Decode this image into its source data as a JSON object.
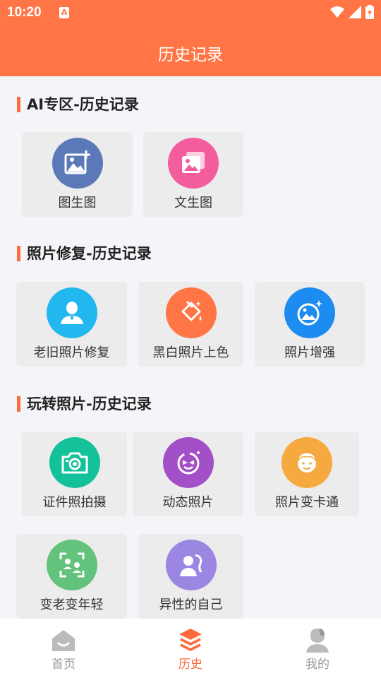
{
  "status_bar": {
    "time": "10:20",
    "app_badge": "A"
  },
  "header": {
    "title": "历史记录"
  },
  "sections": [
    {
      "title": "AI专区-历史记录",
      "cards": [
        {
          "label": "图生图",
          "icon": "image-add-icon",
          "color": "#5b79b8"
        },
        {
          "label": "文生图",
          "icon": "gallery-icon",
          "color": "#f35c9d"
        }
      ]
    },
    {
      "title": "照片修复-历史记录",
      "cards": [
        {
          "label": "老旧照片修复",
          "icon": "person-icon",
          "color": "#22b7ee"
        },
        {
          "label": "黑白照片上色",
          "icon": "paint-bucket-icon",
          "color": "#ff7546"
        },
        {
          "label": "照片增强",
          "icon": "sparkle-photo-icon",
          "color": "#1d8cf1"
        }
      ]
    },
    {
      "title": "玩转照片-历史记录",
      "cards": [
        {
          "label": "证件照拍摄",
          "icon": "camera-icon",
          "color": "#13c29a"
        },
        {
          "label": "动态照片",
          "icon": "smile-face-icon",
          "color": "#a34fc8"
        },
        {
          "label": "照片变卡通",
          "icon": "cartoon-face-icon",
          "color": "#f5a93f"
        },
        {
          "label": "变老变年轻",
          "icon": "people-scan-icon",
          "color": "#63c27c"
        },
        {
          "label": "异性的自己",
          "icon": "gender-profile-icon",
          "color": "#9b87e2"
        }
      ]
    }
  ],
  "bottom_nav": [
    {
      "label": "首页",
      "icon": "home-icon",
      "active": false
    },
    {
      "label": "历史",
      "icon": "layers-icon",
      "active": true
    },
    {
      "label": "我的",
      "icon": "user-icon",
      "active": false
    }
  ],
  "colors": {
    "accent": "#ff7545",
    "active_nav": "#ff6a3c",
    "inactive_nav": "#999999"
  }
}
